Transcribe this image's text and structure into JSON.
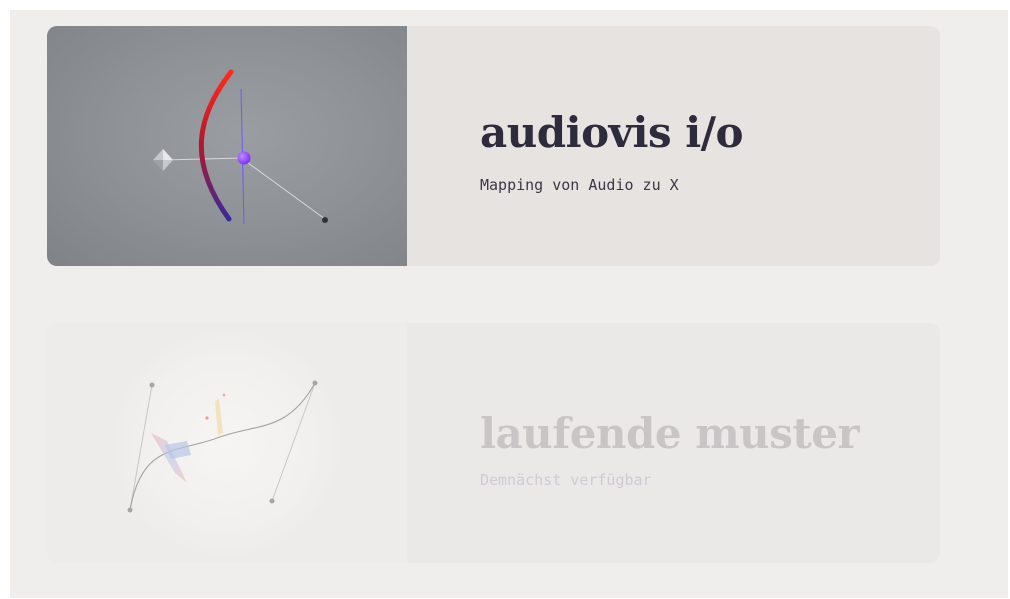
{
  "projects": [
    {
      "title": "audiovis i/o",
      "subtitle": "Mapping von Audio zu X",
      "status": "available"
    },
    {
      "title": "laufende muster",
      "subtitle": "Demnächst verfügbar",
      "status": "coming-soon"
    }
  ],
  "colors": {
    "page_background": "#efeeec",
    "card_background": "#e7e3e1",
    "title_color": "#2d2b3c",
    "disabled_text": "#c9c5c7",
    "accent_purple": "#7b3cff",
    "accent_red": "#e0202a"
  }
}
